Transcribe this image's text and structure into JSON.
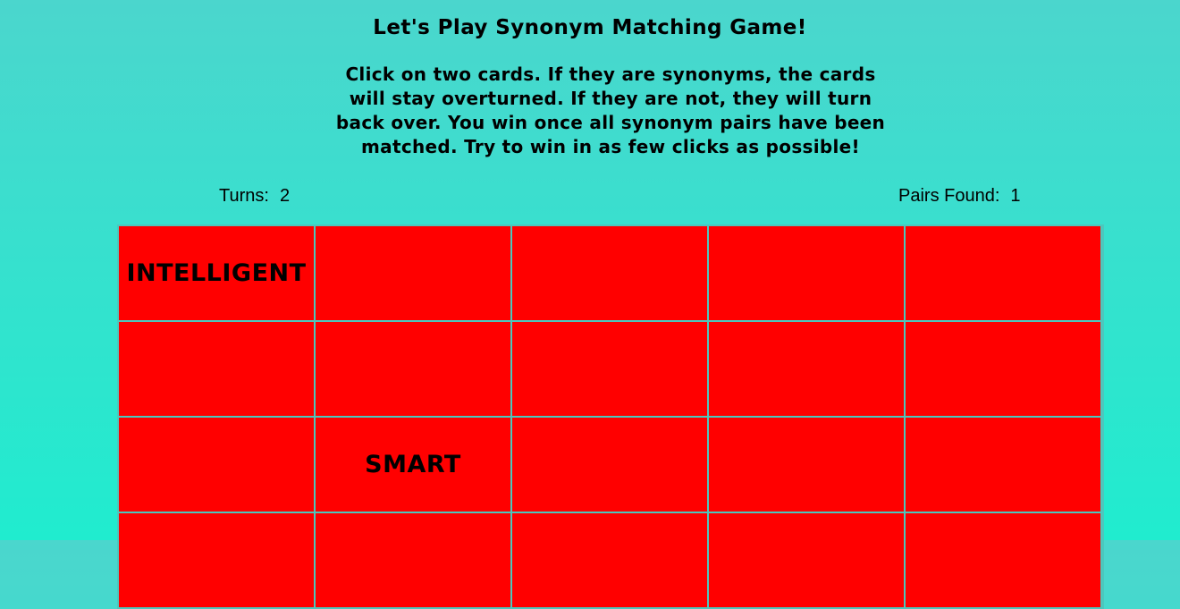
{
  "game": {
    "title": "Let's Play Synonym Matching Game!",
    "instructions": "Click on two cards. If they are synonyms, the cards will stay overturned. If they are not, they will turn back over. You win once all synonym pairs have been matched. Try to win in as few clicks as possible!"
  },
  "stats": {
    "turns_label": "Turns:",
    "turns_value": "2",
    "pairs_label": "Pairs Found:",
    "pairs_value": "1"
  },
  "colors": {
    "background_top": "#4bd6cd",
    "background_bottom": "#20eccf",
    "card_back": "#ff0000",
    "text": "#000000"
  },
  "board": {
    "cards": [
      "INTELLIGENT",
      "",
      "",
      "",
      "",
      "",
      "",
      "",
      "",
      "",
      "",
      "SMART",
      "",
      "",
      "",
      "",
      "",
      "",
      "",
      ""
    ]
  }
}
